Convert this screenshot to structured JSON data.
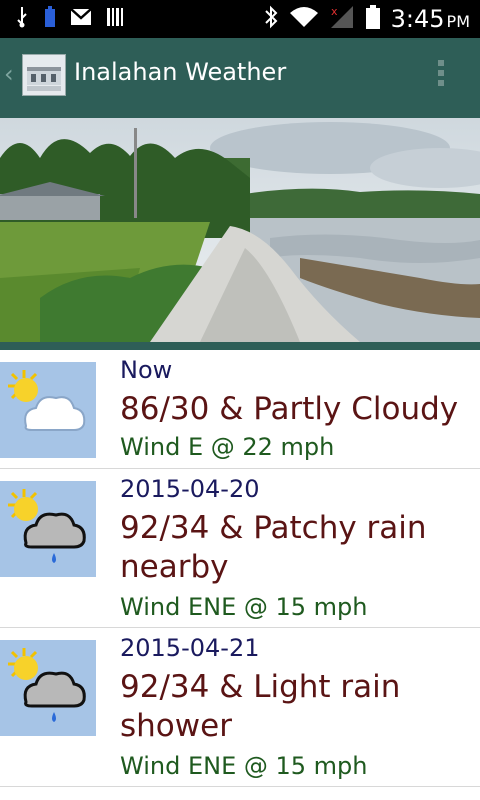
{
  "status_bar": {
    "time": "3:45",
    "ampm": "PM"
  },
  "app": {
    "title": "Inalahan Weather"
  },
  "forecasts": [
    {
      "date": "Now",
      "summary": "86/30 & Partly Cloudy",
      "wind": "Wind E @ 22 mph",
      "icon": "partly-cloudy"
    },
    {
      "date": "2015-04-20",
      "summary": "92/34 & Patchy rain nearby",
      "wind": "Wind ENE @ 15 mph",
      "icon": "patchy-rain"
    },
    {
      "date": "2015-04-21",
      "summary": "92/34 & Light rain shower",
      "wind": "Wind ENE @ 15 mph",
      "icon": "light-rain"
    }
  ],
  "colors": {
    "actionbar": "#2e5e57",
    "date": "#1a1a5e",
    "summary": "#5a1414",
    "wind": "#1f5a1f",
    "thumb": "#a6c4e6"
  }
}
